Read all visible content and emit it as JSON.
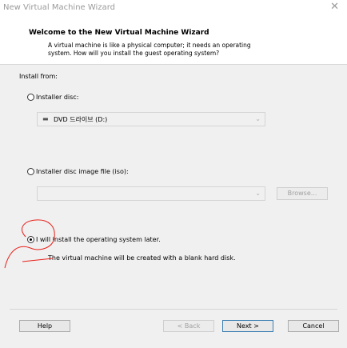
{
  "window": {
    "title": "New Virtual Machine Wizard",
    "close_glyph": "✕"
  },
  "header": {
    "title": "Welcome to the New Virtual Machine Wizard",
    "desc_line1": "A virtual machine is like a physical computer; it needs an operating",
    "desc_line2": "system. How will you install the guest operating system?"
  },
  "install_from": {
    "label": "Install from:",
    "installer_disc": {
      "label": "Installer disc:",
      "selected": false,
      "value": "DVD 드라이브 (D:)"
    },
    "iso": {
      "label": "Installer disc image file (iso):",
      "selected": false,
      "path": "",
      "browse_label": "Browse..."
    },
    "later": {
      "label": "I will install the operating system later.",
      "selected": true,
      "note": "The virtual machine will be created with a blank hard disk."
    }
  },
  "buttons": {
    "help": "Help",
    "back": "< Back",
    "next": "Next >",
    "cancel": "Cancel"
  },
  "annotation_color": "#e8211a"
}
